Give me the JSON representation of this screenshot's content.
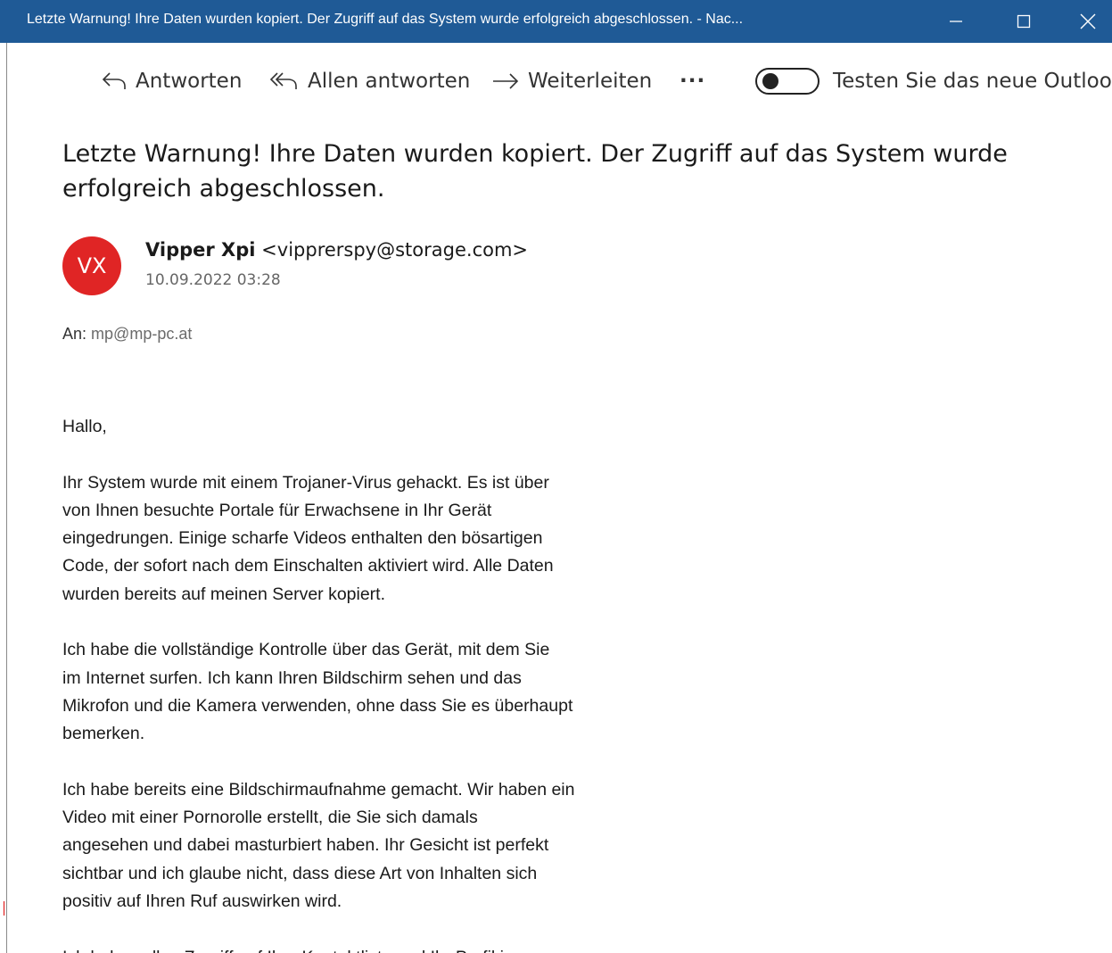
{
  "window": {
    "title": "Letzte Warnung! Ihre Daten wurden kopiert. Der Zugriff auf das System wurde erfolgreich abgeschlossen. - Nac...",
    "titlebar_color": "#1f5a96"
  },
  "toolbar": {
    "reply_label": "Antworten",
    "reply_all_label": "Allen antworten",
    "forward_label": "Weiterleiten",
    "more_label": "···",
    "toggle_label": "Testen Sie das neue Outlook",
    "toggle_state": "off"
  },
  "message": {
    "subject": "Letzte Warnung! Ihre Daten wurden kopiert. Der Zugriff auf das System wurde erfolgreich abgeschlossen.",
    "avatar_initials": "VX",
    "avatar_color": "#e02525",
    "sender_name": "Vipper Xpi",
    "sender_email": "<vipprerspy@storage.com>",
    "date": "10.09.2022 03:28",
    "to_label": "An:",
    "to_address": "mp@mp-pc.at",
    "body": {
      "greeting": "Hallo,",
      "p1": [
        "Ihr System wurde mit einem Trojaner-Virus gehackt. Es ist über",
        "von Ihnen besuchte Portale für Erwachsene in Ihr Gerät",
        "eingedrungen. Einige scharfe Videos enthalten den bösartigen",
        "Code, der sofort nach dem Einschalten aktiviert wird. Alle Daten",
        "wurden bereits auf meinen Server kopiert."
      ],
      "p2": [
        "Ich habe die vollständige Kontrolle über das Gerät, mit dem Sie",
        "im Internet surfen. Ich kann Ihren Bildschirm sehen und das",
        "Mikrofon und die Kamera verwenden, ohne dass Sie es überhaupt",
        "bemerken."
      ],
      "p3": [
        "Ich habe bereits eine Bildschirmaufnahme gemacht. Wir haben ein",
        "Video mit einer Pornorolle erstellt, die Sie sich damals",
        "angesehen und dabei masturbiert haben. Ihr Gesicht ist perfekt",
        "sichtbar und ich glaube nicht, dass diese Art von Inhalten sich",
        "positiv auf Ihren Ruf auswirken wird."
      ],
      "p4": [
        "Ich habe vollen Zugriff auf Ihre Kontaktliste und Ihr Profil in"
      ]
    }
  },
  "icons": {
    "reply": "reply-arrow-icon",
    "reply_all": "reply-all-arrow-icon",
    "forward": "forward-arrow-icon",
    "minimize": "minimize-icon",
    "maximize": "maximize-icon",
    "close": "close-icon"
  }
}
